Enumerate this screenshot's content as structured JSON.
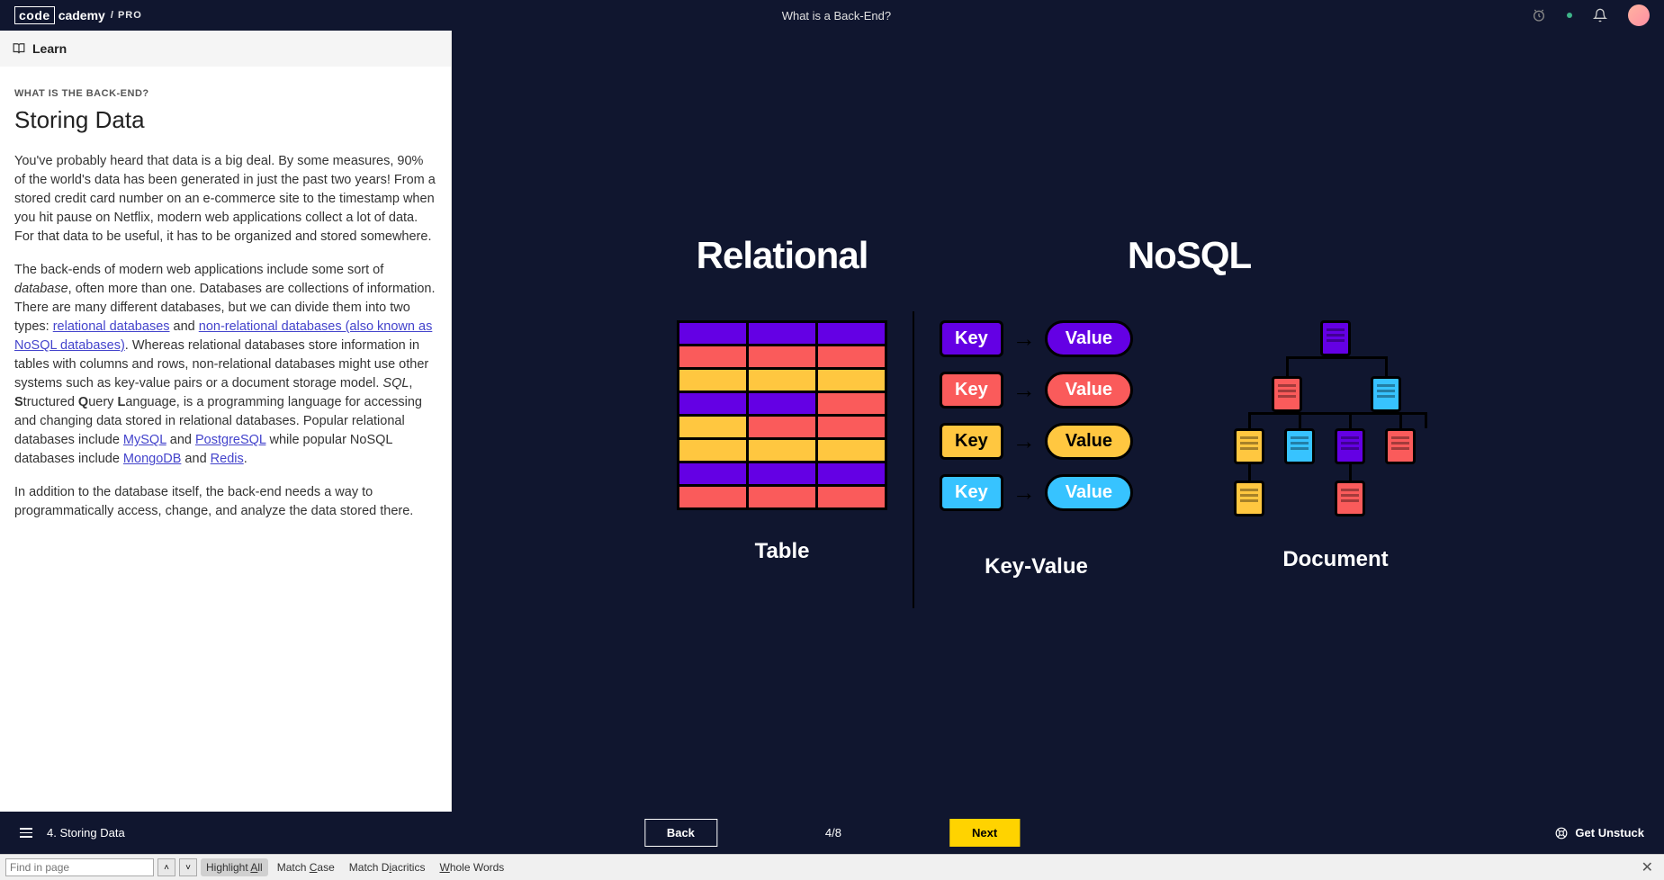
{
  "header": {
    "logo_box": "code",
    "logo_text": "cademy",
    "logo_pro": "/ PRO",
    "title": "What is a Back-End?"
  },
  "learn_bar": {
    "label": "Learn"
  },
  "lesson": {
    "eyebrow": "WHAT IS THE BACK-END?",
    "title": "Storing Data",
    "p1": "You've probably heard that data is a big deal. By some measures, 90% of the world's data has been generated in just the past two years! From a stored credit card number on an e-commerce site to the timestamp when you hit pause on Netflix, modern web applications collect a lot of data. For that data to be useful, it has to be organized and stored somewhere.",
    "p2_a": "The back-ends of modern web applications include some sort of ",
    "p2_em": "database",
    "p2_b": ", often more than one. Databases are collections of information. There are many different databases, but we can divide them into two types: ",
    "p2_link1": "relational databases",
    "p2_c": " and ",
    "p2_link2": "non-relational databases (also known as NoSQL databases)",
    "p2_d": ". Whereas relational databases store information in tables with columns and rows, non-relational databases might use other systems such as key-value pairs or a document storage model. ",
    "p2_em2": "SQL",
    "p2_e": ", ",
    "p2_sql_s": "S",
    "p2_sql_t": "tructured ",
    "p2_sql_q": "Q",
    "p2_sql_u": "uery ",
    "p2_sql_l": "L",
    "p2_sql_ang": "anguage, is a programming language for accessing and changing data stored in relational databases. Popular relational databases include ",
    "p2_link3": "MySQL",
    "p2_f": " and ",
    "p2_link4": "PostgreSQL",
    "p2_g": " while popular NoSQL databases include ",
    "p2_link5": "MongoDB",
    "p2_h": " and ",
    "p2_link6": "Redis",
    "p2_i": ".",
    "p3": "In addition to the database itself, the back-end needs a way to programmatically access, change, and analyze the data stored there."
  },
  "diagram": {
    "relational": "Relational",
    "nosql": "NoSQL",
    "table": "Table",
    "keyvalue": "Key-Value",
    "document": "Document",
    "key": "Key",
    "value": "Value"
  },
  "nav": {
    "lesson_label": "4. Storing Data",
    "back": "Back",
    "progress": "4/8",
    "next": "Next",
    "unstuck": "Get Unstuck"
  },
  "find": {
    "placeholder": "Find in page",
    "highlight_a": "Highlight ",
    "highlight_u": "A",
    "highlight_b": "ll",
    "matchcase_a": "Match ",
    "matchcase_u": "C",
    "matchcase_b": "ase",
    "diacritics_a": "Match D",
    "diacritics_u": "i",
    "diacritics_b": "acritics",
    "whole_u": "W",
    "whole_b": "hole Words"
  }
}
